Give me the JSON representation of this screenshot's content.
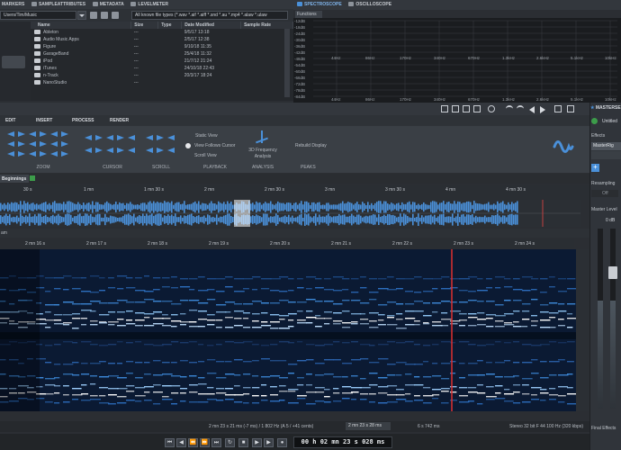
{
  "browser": {
    "tabs": [
      "MARKERS",
      "SAMPLEATTRIBUTES",
      "METADATA",
      "LEVELMETER"
    ],
    "path": "Users/Tim/Music",
    "filter": "All known file types (*.wav *.aif *.aiff *.snd *.au *.mp4 *.alaw *.ulaw",
    "columns": [
      "Name",
      "Size",
      "Type",
      "Date Modified",
      "Sample Rate"
    ],
    "rows": [
      {
        "name": "Ableton",
        "size": "---",
        "date": "9/5/17 13:18"
      },
      {
        "name": "Audio Music Apps",
        "size": "---",
        "date": "2/5/17 12:38"
      },
      {
        "name": "Figure",
        "size": "---",
        "date": "9/10/18 11:35"
      },
      {
        "name": "GarageBand",
        "size": "---",
        "date": "25/4/18 11:32"
      },
      {
        "name": "iPod",
        "size": "---",
        "date": "21/7/12 21:24"
      },
      {
        "name": "iTunes",
        "size": "---",
        "date": "24/10/18 22:43"
      },
      {
        "name": "n-Track",
        "size": "---",
        "date": "20/3/17 18:24"
      },
      {
        "name": "NanoStudio",
        "size": "---",
        "date": ""
      }
    ]
  },
  "spectroscope": {
    "tabs": [
      "SPECTROSCOPE",
      "OSCILLOSCOPE"
    ],
    "menu": "Functions",
    "db_labels": [
      "-12dB",
      "-18dB",
      "-24dB",
      "-30dB",
      "-36dB",
      "-42dB",
      "-48dB",
      "-54dB",
      "-60dB",
      "-66dB",
      "-72dB",
      "-78dB",
      "-84dB"
    ],
    "freq_labels": [
      "44Hz",
      "86Hz",
      "170Hz",
      "340Hz",
      "670Hz",
      "1.3kHz",
      "2.6kHz",
      "5.1kHz",
      "10kHz"
    ]
  },
  "ribbon": {
    "tabs": [
      "EDIT",
      "INSERT",
      "PROCESS",
      "RENDER"
    ],
    "groups": [
      "ZOOM",
      "CURSOR",
      "SCROLL",
      "PLAYBACK",
      "ANALYSIS",
      "PEAKS"
    ],
    "playback_options": [
      "Static View",
      "View Follows Cursor",
      "Scroll View"
    ],
    "analysis_label": "3D Frequency Analysis",
    "peaks_label": "Rebuild Display"
  },
  "editor": {
    "title": "Beginnings",
    "overview_ruler": [
      "30 s",
      "1 mn",
      "1 mn 30 s",
      "2 mn",
      "2 mn 30 s",
      "3 mn",
      "3 mn 30 s",
      "4 mn",
      "4 mn 30 s"
    ],
    "zoom_label": "am",
    "detail_ruler": [
      "2 mn 16 s",
      "2 mn 17 s",
      "2 mn 18 s",
      "2 mn 19 s",
      "2 mn 20 s",
      "2 mn 21 s",
      "2 mn 22 s",
      "2 mn 23 s",
      "2 mn 24 s"
    ]
  },
  "status": {
    "position": "2 mn 23 s 21 ms (-7 ms) / 1 802 Hz (A 5 / +41 cents)",
    "selection": "2 mn 23 s 28 ms",
    "length": "6 s 742 ms",
    "format": "Stereo 32 bit F 44 100 Hz (320 kbps)"
  },
  "transport": {
    "time": "00 h 02 mn 23 s 028 ms"
  },
  "master": {
    "title": "MASTERSE",
    "untitled": "Untitled",
    "effects": "Effects",
    "plugin": "MasterRig",
    "resampling": "Resampling",
    "off": "Off",
    "master_level": "Master Level",
    "level_db": "0 dB",
    "final_effects": "Final Effects"
  },
  "colors": {
    "accent": "#4a90d9",
    "cursor": "#e03030",
    "spectrum_bg": "#0a1830"
  }
}
